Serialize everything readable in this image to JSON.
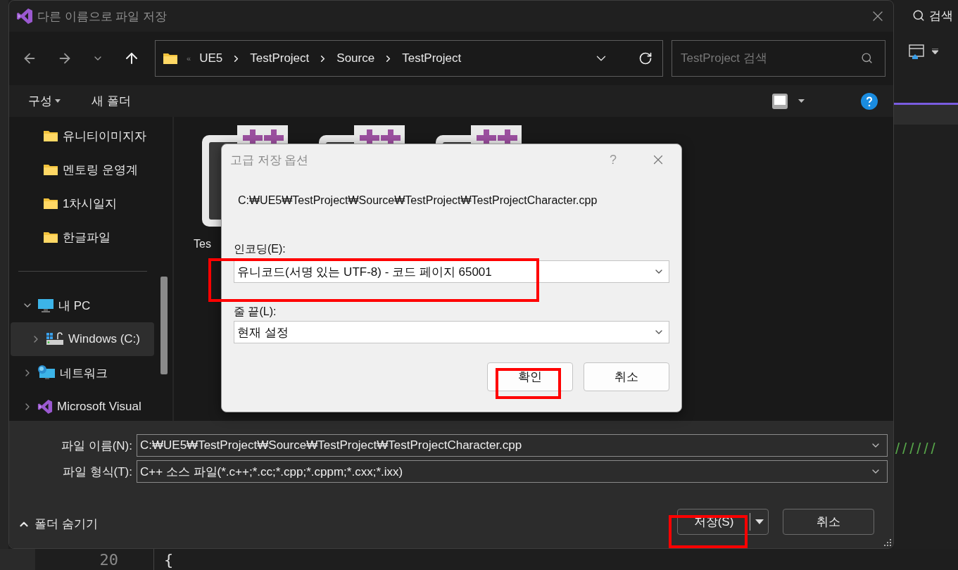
{
  "dialog": {
    "title": "다른 이름으로 파일 저장",
    "address": {
      "overflow": "«",
      "crumbs": [
        "UE5",
        "TestProject",
        "Source",
        "TestProject"
      ]
    },
    "search": {
      "placeholder": "TestProject 검색"
    },
    "commands": [
      {
        "label": "구성",
        "dropdown": true
      },
      {
        "label": "새 폴더",
        "dropdown": false
      }
    ],
    "quick_access": [
      {
        "label": "유니티이미지자",
        "kind": "folder"
      },
      {
        "label": "멘토링 운영계",
        "kind": "folder"
      },
      {
        "label": "1차시일지",
        "kind": "folder"
      },
      {
        "label": "한글파일",
        "kind": "folder"
      }
    ],
    "tree": [
      {
        "label": "내 PC",
        "kind": "pc",
        "expanded": true,
        "selected": false,
        "children": [
          {
            "label": "Windows (C:)",
            "kind": "drive",
            "expanded": false,
            "selected": true
          }
        ]
      },
      {
        "label": "네트워크",
        "kind": "network",
        "expanded": false,
        "selected": false
      },
      {
        "label": "Microsoft Visual",
        "kind": "vs",
        "expanded": false,
        "selected": false
      }
    ],
    "files": [
      {
        "kind": "cpp",
        "label": "Tes"
      },
      {
        "kind": "cpp"
      },
      {
        "kind": "cpp"
      }
    ],
    "fields": [
      {
        "label": "파일 이름(N):",
        "value": "C:₩UE5₩TestProject₩Source₩TestProject₩TestProjectCharacter.cpp"
      },
      {
        "label": "파일 형식(T):",
        "value": "C++ 소스 파일(*.c++;*.cc;*.cpp;*.cppm;*.cxx;*.ixx)"
      }
    ],
    "hide_folders": "폴더 숨기기",
    "save_button": {
      "label": "저장(S)",
      "highlighted": true
    },
    "cancel_button": {
      "label": "취소",
      "highlighted": false
    }
  },
  "modal": {
    "title": "고급 저장 옵션",
    "help": "?",
    "path": "C:₩UE5₩TestProject₩Source₩TestProject₩TestProjectCharacter.cpp",
    "selects": [
      {
        "label": "인코딩(E):",
        "value": "유니코드(서명 있는 UTF-8) - 코드 페이지 65001",
        "highlighted": true
      },
      {
        "label": "줄 끝(L):",
        "value": "현재 설정",
        "highlighted": false
      }
    ],
    "buttons": [
      {
        "label": "확인",
        "highlighted": true
      },
      {
        "label": "취소",
        "highlighted": false
      }
    ]
  },
  "editor": {
    "search_label": "검색",
    "comment": "//////",
    "line_number": "20",
    "code": "{"
  }
}
